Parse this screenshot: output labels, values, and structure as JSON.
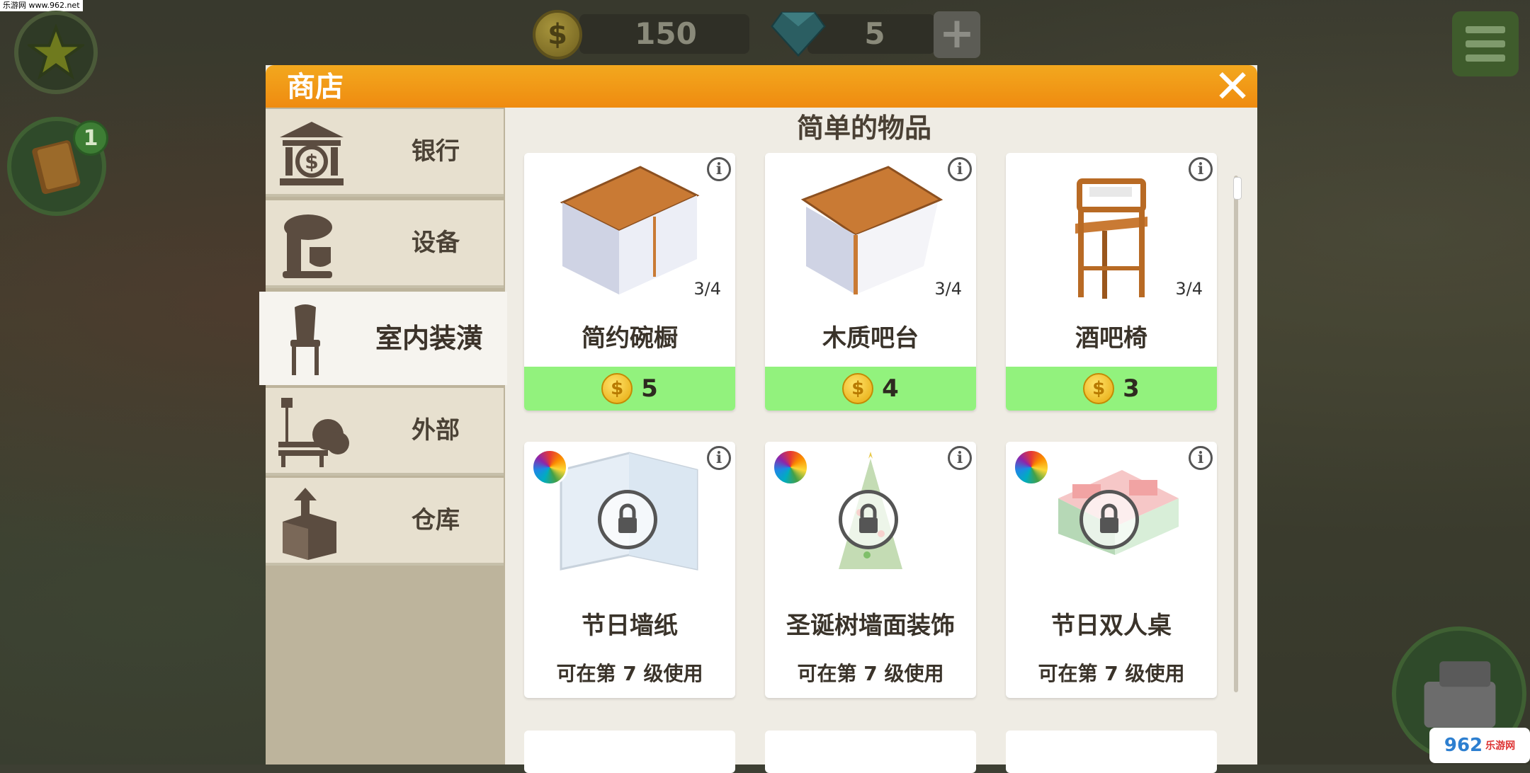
{
  "watermark": "乐游网 www.962.net",
  "hud": {
    "coins": "150",
    "gems": "5",
    "plus_label": "+",
    "book_badge": "1",
    "logo_text": "962",
    "logo_sub": "乐游网"
  },
  "shop": {
    "title": "商店",
    "close_label": "✕",
    "section_title": "简单的物品",
    "tabs": [
      {
        "label": "银行",
        "icon": "bank-icon"
      },
      {
        "label": "设备",
        "icon": "mixer-icon"
      },
      {
        "label": "室内装潢",
        "icon": "chair-icon",
        "active": true
      },
      {
        "label": "外部",
        "icon": "bench-icon"
      },
      {
        "label": "仓库",
        "icon": "box-icon"
      }
    ],
    "items": [
      {
        "name": "简约碗橱",
        "count": "3/4",
        "price": "5",
        "icon": "cupboard-icon"
      },
      {
        "name": "木质吧台",
        "count": "3/4",
        "price": "4",
        "icon": "bar-counter-icon"
      },
      {
        "name": "酒吧椅",
        "count": "3/4",
        "price": "3",
        "icon": "bar-stool-icon"
      },
      {
        "name": "节日墙纸",
        "level": "可在第 7 级使用",
        "icon": "wallpaper-icon"
      },
      {
        "name": "圣诞树墙面装饰",
        "level": "可在第 7 级使用",
        "icon": "christmas-tree-icon"
      },
      {
        "name": "节日双人桌",
        "level": "可在第 7 级使用",
        "icon": "festive-table-icon"
      }
    ]
  },
  "colors": {
    "header_orange": "#f0901a",
    "price_green": "#92f27d",
    "sidebar": "#bdb49c"
  }
}
